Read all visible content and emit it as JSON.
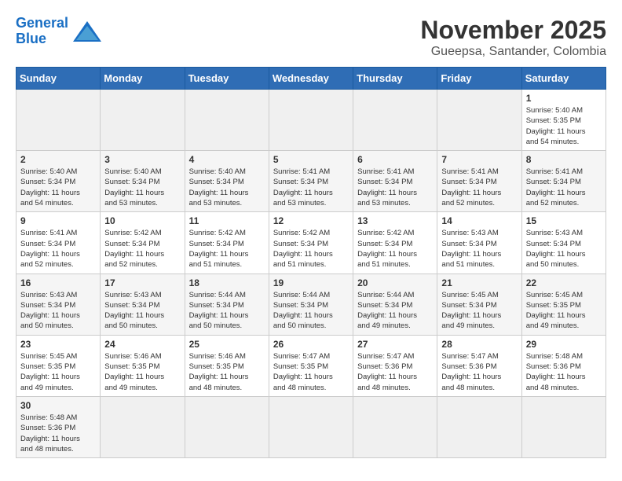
{
  "logo": {
    "text_general": "General",
    "text_blue": "Blue"
  },
  "title": {
    "month_year": "November 2025",
    "location": "Gueepsa, Santander, Colombia"
  },
  "weekdays": [
    "Sunday",
    "Monday",
    "Tuesday",
    "Wednesday",
    "Thursday",
    "Friday",
    "Saturday"
  ],
  "weeks": [
    [
      {
        "day": "",
        "info": ""
      },
      {
        "day": "",
        "info": ""
      },
      {
        "day": "",
        "info": ""
      },
      {
        "day": "",
        "info": ""
      },
      {
        "day": "",
        "info": ""
      },
      {
        "day": "",
        "info": ""
      },
      {
        "day": "1",
        "info": "Sunrise: 5:40 AM\nSunset: 5:35 PM\nDaylight: 11 hours\nand 54 minutes."
      }
    ],
    [
      {
        "day": "2",
        "info": "Sunrise: 5:40 AM\nSunset: 5:34 PM\nDaylight: 11 hours\nand 54 minutes."
      },
      {
        "day": "3",
        "info": "Sunrise: 5:40 AM\nSunset: 5:34 PM\nDaylight: 11 hours\nand 53 minutes."
      },
      {
        "day": "4",
        "info": "Sunrise: 5:40 AM\nSunset: 5:34 PM\nDaylight: 11 hours\nand 53 minutes."
      },
      {
        "day": "5",
        "info": "Sunrise: 5:41 AM\nSunset: 5:34 PM\nDaylight: 11 hours\nand 53 minutes."
      },
      {
        "day": "6",
        "info": "Sunrise: 5:41 AM\nSunset: 5:34 PM\nDaylight: 11 hours\nand 53 minutes."
      },
      {
        "day": "7",
        "info": "Sunrise: 5:41 AM\nSunset: 5:34 PM\nDaylight: 11 hours\nand 52 minutes."
      },
      {
        "day": "8",
        "info": "Sunrise: 5:41 AM\nSunset: 5:34 PM\nDaylight: 11 hours\nand 52 minutes."
      }
    ],
    [
      {
        "day": "9",
        "info": "Sunrise: 5:41 AM\nSunset: 5:34 PM\nDaylight: 11 hours\nand 52 minutes."
      },
      {
        "day": "10",
        "info": "Sunrise: 5:42 AM\nSunset: 5:34 PM\nDaylight: 11 hours\nand 52 minutes."
      },
      {
        "day": "11",
        "info": "Sunrise: 5:42 AM\nSunset: 5:34 PM\nDaylight: 11 hours\nand 51 minutes."
      },
      {
        "day": "12",
        "info": "Sunrise: 5:42 AM\nSunset: 5:34 PM\nDaylight: 11 hours\nand 51 minutes."
      },
      {
        "day": "13",
        "info": "Sunrise: 5:42 AM\nSunset: 5:34 PM\nDaylight: 11 hours\nand 51 minutes."
      },
      {
        "day": "14",
        "info": "Sunrise: 5:43 AM\nSunset: 5:34 PM\nDaylight: 11 hours\nand 51 minutes."
      },
      {
        "day": "15",
        "info": "Sunrise: 5:43 AM\nSunset: 5:34 PM\nDaylight: 11 hours\nand 50 minutes."
      }
    ],
    [
      {
        "day": "16",
        "info": "Sunrise: 5:43 AM\nSunset: 5:34 PM\nDaylight: 11 hours\nand 50 minutes."
      },
      {
        "day": "17",
        "info": "Sunrise: 5:43 AM\nSunset: 5:34 PM\nDaylight: 11 hours\nand 50 minutes."
      },
      {
        "day": "18",
        "info": "Sunrise: 5:44 AM\nSunset: 5:34 PM\nDaylight: 11 hours\nand 50 minutes."
      },
      {
        "day": "19",
        "info": "Sunrise: 5:44 AM\nSunset: 5:34 PM\nDaylight: 11 hours\nand 50 minutes."
      },
      {
        "day": "20",
        "info": "Sunrise: 5:44 AM\nSunset: 5:34 PM\nDaylight: 11 hours\nand 49 minutes."
      },
      {
        "day": "21",
        "info": "Sunrise: 5:45 AM\nSunset: 5:34 PM\nDaylight: 11 hours\nand 49 minutes."
      },
      {
        "day": "22",
        "info": "Sunrise: 5:45 AM\nSunset: 5:35 PM\nDaylight: 11 hours\nand 49 minutes."
      }
    ],
    [
      {
        "day": "23",
        "info": "Sunrise: 5:45 AM\nSunset: 5:35 PM\nDaylight: 11 hours\nand 49 minutes."
      },
      {
        "day": "24",
        "info": "Sunrise: 5:46 AM\nSunset: 5:35 PM\nDaylight: 11 hours\nand 49 minutes."
      },
      {
        "day": "25",
        "info": "Sunrise: 5:46 AM\nSunset: 5:35 PM\nDaylight: 11 hours\nand 48 minutes."
      },
      {
        "day": "26",
        "info": "Sunrise: 5:47 AM\nSunset: 5:35 PM\nDaylight: 11 hours\nand 48 minutes."
      },
      {
        "day": "27",
        "info": "Sunrise: 5:47 AM\nSunset: 5:36 PM\nDaylight: 11 hours\nand 48 minutes."
      },
      {
        "day": "28",
        "info": "Sunrise: 5:47 AM\nSunset: 5:36 PM\nDaylight: 11 hours\nand 48 minutes."
      },
      {
        "day": "29",
        "info": "Sunrise: 5:48 AM\nSunset: 5:36 PM\nDaylight: 11 hours\nand 48 minutes."
      }
    ],
    [
      {
        "day": "30",
        "info": "Sunrise: 5:48 AM\nSunset: 5:36 PM\nDaylight: 11 hours\nand 48 minutes."
      },
      {
        "day": "",
        "info": ""
      },
      {
        "day": "",
        "info": ""
      },
      {
        "day": "",
        "info": ""
      },
      {
        "day": "",
        "info": ""
      },
      {
        "day": "",
        "info": ""
      },
      {
        "day": "",
        "info": ""
      }
    ]
  ]
}
